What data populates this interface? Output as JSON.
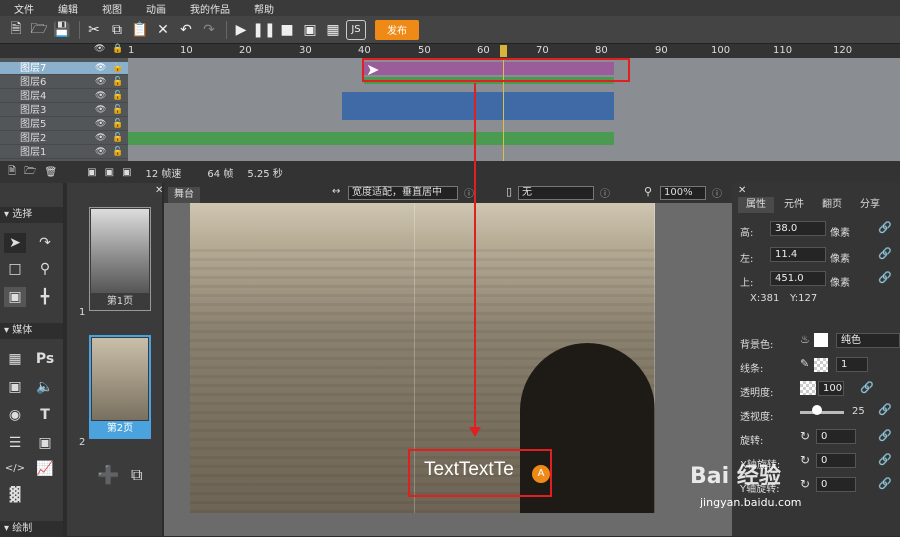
{
  "menu": [
    "文件",
    "编辑",
    "视图",
    "动画",
    "我的作品",
    "帮助"
  ],
  "toolbar": {
    "publish_label": "发布"
  },
  "ruler": [
    "1",
    "10",
    "20",
    "30",
    "40",
    "50",
    "60",
    "70",
    "80",
    "90",
    "100",
    "110",
    "120"
  ],
  "layers": [
    {
      "name": "图层7",
      "selected": true
    },
    {
      "name": "图层6",
      "selected": false
    },
    {
      "name": "图层4",
      "selected": false
    },
    {
      "name": "图层3",
      "selected": false
    },
    {
      "name": "图层5",
      "selected": false
    },
    {
      "name": "图层2",
      "selected": false
    },
    {
      "name": "图层1",
      "selected": false
    }
  ],
  "status": {
    "fps": "12 帧速",
    "frames": "64 帧",
    "seconds": "5.25 秒"
  },
  "tools": {
    "select": "选择",
    "media": "媒体",
    "draw": "绘制"
  },
  "pages": [
    {
      "num": "1",
      "label": "第1页"
    },
    {
      "num": "2",
      "label": "第2页"
    }
  ],
  "stagebar": {
    "tab": "舞台",
    "fit": "宽度适配，垂直居中",
    "device": "无",
    "zoom": "100%"
  },
  "props": {
    "tabs": [
      "属性",
      "元件",
      "翻页",
      "分享"
    ],
    "height": {
      "label": "高:",
      "value": "38.0",
      "unit": "像素"
    },
    "left": {
      "label": "左:",
      "value": "11.4",
      "unit": "像素"
    },
    "top": {
      "label": "上:",
      "value": "451.0",
      "unit": "像素"
    },
    "coords": {
      "x": "X:381",
      "y": "Y:127"
    },
    "bg": {
      "label": "背景色:",
      "mode": "纯色"
    },
    "stroke": {
      "label": "线条:",
      "value": "1"
    },
    "opacity": {
      "label": "透明度:",
      "value": "100"
    },
    "blur": {
      "label": "透视度:",
      "value": "25"
    },
    "rotate": {
      "label": "旋转:",
      "value": "0"
    },
    "rotx": {
      "label": "X轴旋转:",
      "value": "0"
    },
    "roty": {
      "label": "Y轴旋转:",
      "value": "0"
    }
  },
  "stage_text": "TextTextTe",
  "watermark": {
    "brand": "Bai 经验",
    "url": "jingyan.baidu.com"
  },
  "colors": {
    "accent": "#f08a16",
    "highlight": "#e02020"
  }
}
